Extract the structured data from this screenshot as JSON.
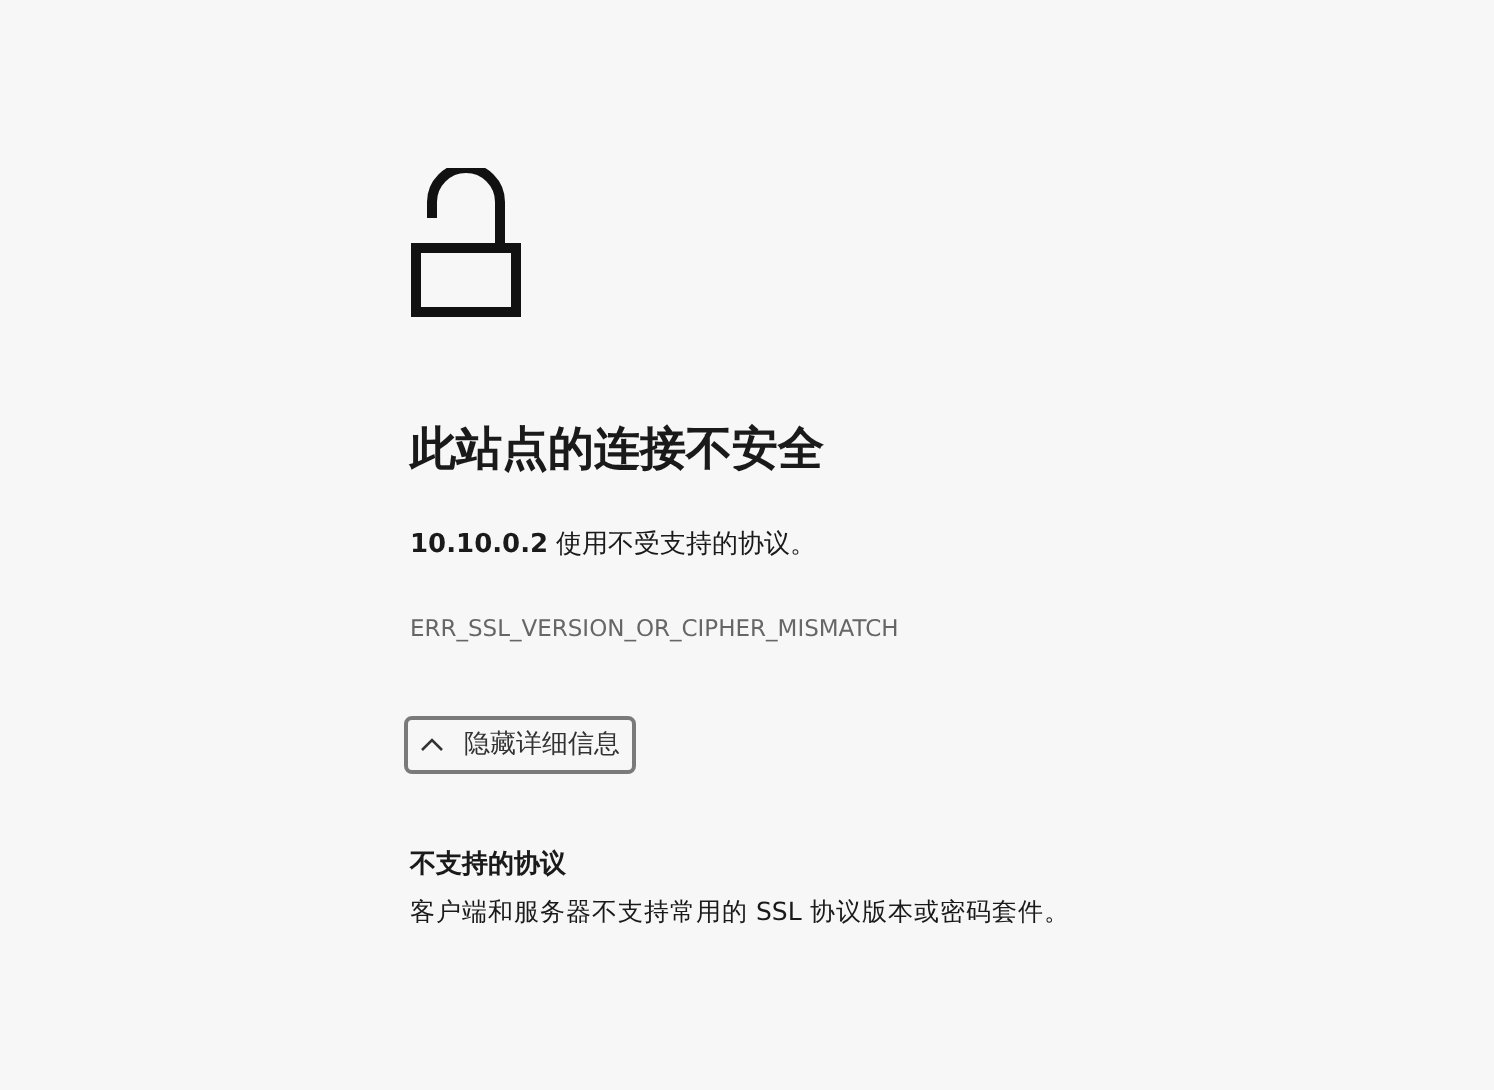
{
  "heading": "此站点的连接不安全",
  "message": "**10.10.0.2** 使用不受支持的协议。",
  "error_code": "ERR_SSL_VERSION_OR_CIPHER_MISMATCH",
  "details_button": {
    "label": "隐藏详细信息",
    "expanded": true
  },
  "details": {
    "title": "不支持的协议",
    "body": "客户端和服务器不支持常用的 SSL 协议版本或密码套件。"
  }
}
